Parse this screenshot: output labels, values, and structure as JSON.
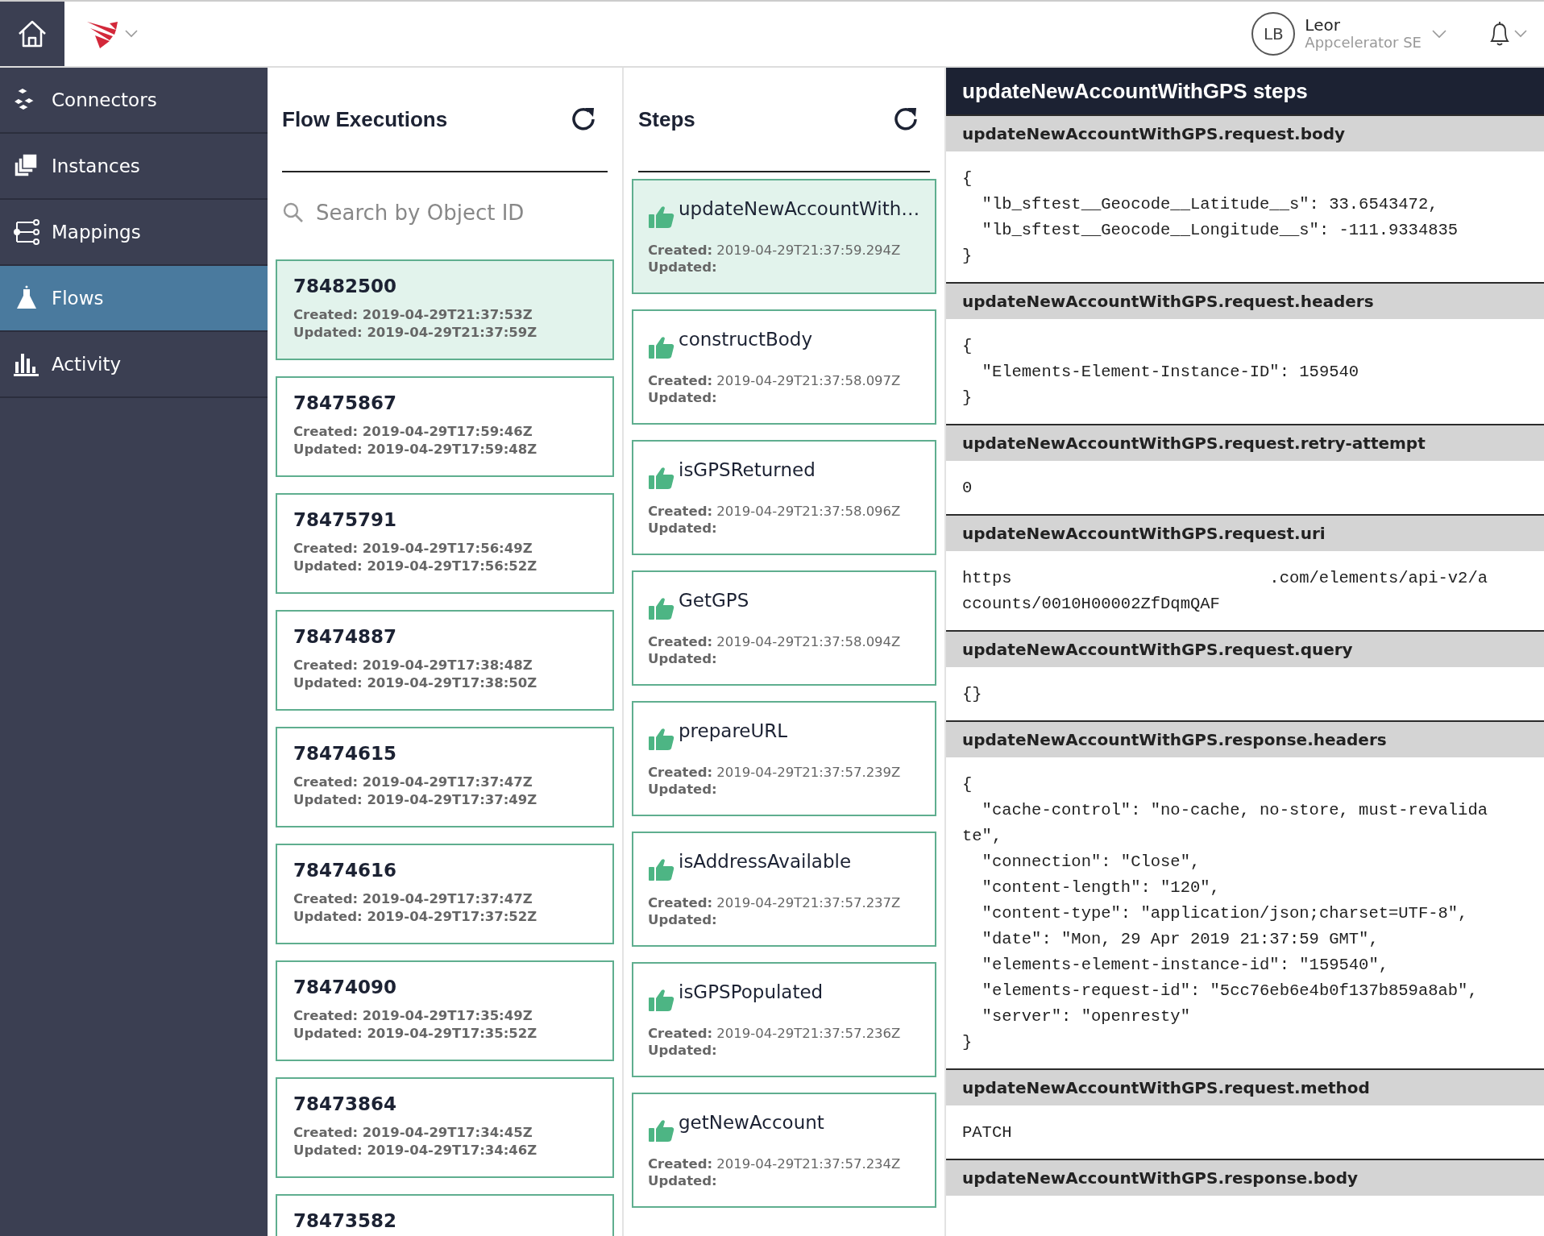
{
  "topbar": {
    "user": {
      "initials": "LB",
      "name": "Leor",
      "role": "Appcelerator SE"
    }
  },
  "sidebar": {
    "items": [
      {
        "label": "Connectors",
        "selected": false
      },
      {
        "label": "Instances",
        "selected": false
      },
      {
        "label": "Mappings",
        "selected": false
      },
      {
        "label": "Flows",
        "selected": true
      },
      {
        "label": "Activity",
        "selected": false
      }
    ]
  },
  "executions": {
    "title": "Flow Executions",
    "search": {
      "placeholder": "Search by Object ID"
    },
    "items": [
      {
        "id": "78482500",
        "created": "Created: 2019-04-29T21:37:53Z",
        "updated": "Updated: 2019-04-29T21:37:59Z",
        "selected": true
      },
      {
        "id": "78475867",
        "created": "Created: 2019-04-29T17:59:46Z",
        "updated": "Updated: 2019-04-29T17:59:48Z",
        "selected": false
      },
      {
        "id": "78475791",
        "created": "Created: 2019-04-29T17:56:49Z",
        "updated": "Updated: 2019-04-29T17:56:52Z",
        "selected": false
      },
      {
        "id": "78474887",
        "created": "Created: 2019-04-29T17:38:48Z",
        "updated": "Updated: 2019-04-29T17:38:50Z",
        "selected": false
      },
      {
        "id": "78474615",
        "created": "Created: 2019-04-29T17:37:47Z",
        "updated": "Updated: 2019-04-29T17:37:49Z",
        "selected": false
      },
      {
        "id": "78474616",
        "created": "Created: 2019-04-29T17:37:47Z",
        "updated": "Updated: 2019-04-29T17:37:52Z",
        "selected": false
      },
      {
        "id": "78474090",
        "created": "Created: 2019-04-29T17:35:49Z",
        "updated": "Updated: 2019-04-29T17:35:52Z",
        "selected": false
      },
      {
        "id": "78473864",
        "created": "Created: 2019-04-29T17:34:45Z",
        "updated": "Updated: 2019-04-29T17:34:46Z",
        "selected": false
      },
      {
        "id": "78473582",
        "selected": false
      }
    ]
  },
  "steps": {
    "title": "Steps",
    "items": [
      {
        "name": "updateNewAccountWith…",
        "created": "**Created:** 2019-04-29T21:37:59.294Z",
        "updated": "Updated:",
        "selected": true
      },
      {
        "name": "constructBody",
        "created": "**Created:** 2019-04-29T21:37:58.097Z",
        "updated": "Updated:",
        "selected": false
      },
      {
        "name": "isGPSReturned",
        "created": "**Created:** 2019-04-29T21:37:58.096Z",
        "updated": "Updated:",
        "selected": false
      },
      {
        "name": "GetGPS",
        "created": "**Created:** 2019-04-29T21:37:58.094Z",
        "updated": "Updated:",
        "selected": false
      },
      {
        "name": "prepareURL",
        "created": "**Created:** 2019-04-29T21:37:57.239Z",
        "updated": "Updated:",
        "selected": false
      },
      {
        "name": "isAddressAvailable",
        "created": "**Created:** 2019-04-29T21:37:57.237Z",
        "updated": "Updated:",
        "selected": false
      },
      {
        "name": "isGPSPopulated",
        "created": "**Created:** 2019-04-29T21:37:57.236Z",
        "updated": "Updated:",
        "selected": false
      },
      {
        "name": "getNewAccount",
        "created": "**Created:** 2019-04-29T21:37:57.234Z",
        "updated": "Updated:",
        "selected": false
      }
    ]
  },
  "details": {
    "title": "updateNewAccountWithGPS steps",
    "sections": [
      {
        "title": "updateNewAccountWithGPS.request.body",
        "body": "{\n  \"lb_sftest__Geocode__Latitude__s\": 33.6543472,\n  \"lb_sftest__Geocode__Longitude__s\": -111.9334835\n}"
      },
      {
        "title": "updateNewAccountWithGPS.request.headers",
        "body": "{\n  \"Elements-Element-Instance-ID\": 159540\n}"
      },
      {
        "title": "updateNewAccountWithGPS.request.retry-attempt",
        "body": "0"
      },
      {
        "title": "updateNewAccountWithGPS.request.uri",
        "body": "https                          .com/elements/api-v2/accounts/0010H00002ZfDqmQAF"
      },
      {
        "title": "updateNewAccountWithGPS.request.query",
        "body": "{}"
      },
      {
        "title": "updateNewAccountWithGPS.response.headers",
        "body": "{\n  \"cache-control\": \"no-cache, no-store, must-revalidate\",\n  \"connection\": \"Close\",\n  \"content-length\": \"120\",\n  \"content-type\": \"application/json;charset=UTF-8\",\n  \"date\": \"Mon, 29 Apr 2019 21:37:59 GMT\",\n  \"elements-element-instance-id\": \"159540\",\n  \"elements-request-id\": \"5cc76eb6e4b0f137b859a8ab\",\n  \"server\": \"openresty\"\n}"
      },
      {
        "title": "updateNewAccountWithGPS.request.method",
        "body": "PATCH"
      },
      {
        "title": "updateNewAccountWithGPS.response.body"
      }
    ]
  }
}
